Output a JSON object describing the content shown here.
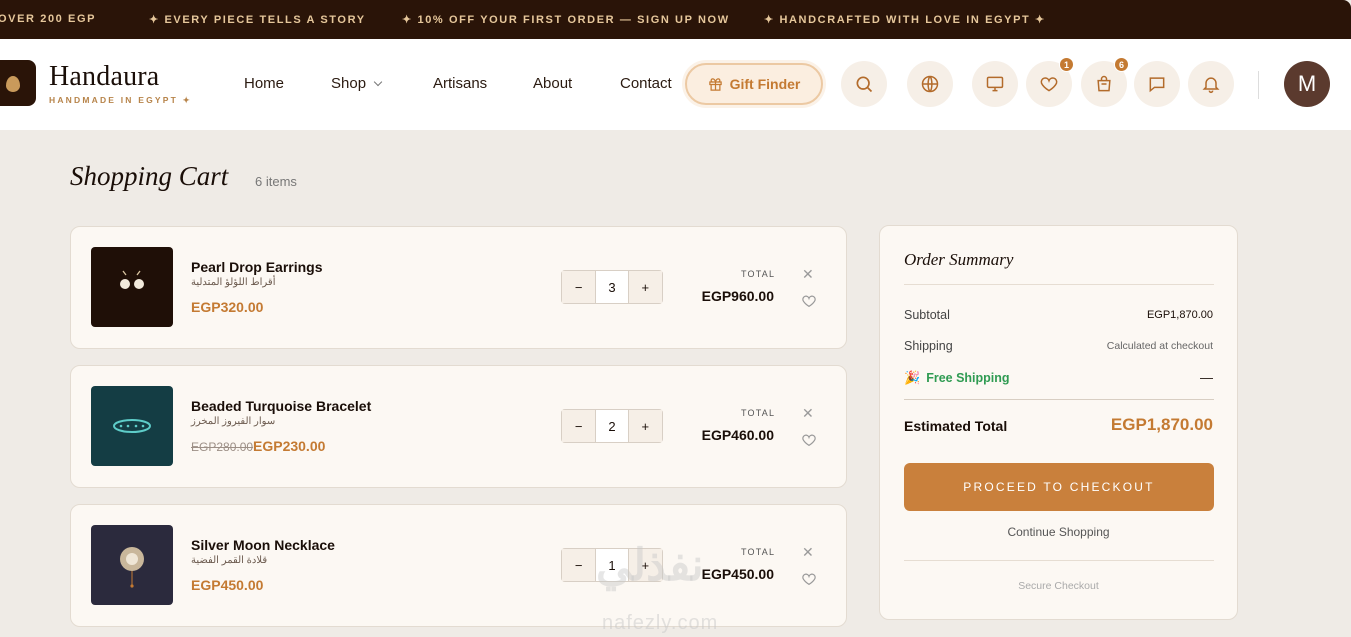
{
  "announcement": {
    "items": [
      "OVER 200 EGP",
      "✦ EVERY PIECE TELLS A STORY",
      "✦ 10% OFF YOUR FIRST ORDER — SIGN UP NOW",
      "✦ HANDCRAFTED WITH LOVE IN EGYPT ✦"
    ]
  },
  "header": {
    "brand": "Handaura",
    "tagline": "HANDMADE IN EGYPT ✦",
    "nav": [
      "Home",
      "Shop",
      "Artisans",
      "About",
      "Contact"
    ],
    "gift_finder": "Gift Finder",
    "wishlist_count": "1",
    "cart_count": "6",
    "avatar_initial": "M",
    "icons": [
      "search-icon",
      "globe-icon",
      "monitor-icon",
      "heart-icon",
      "bag-icon",
      "chat-icon",
      "bell-icon"
    ]
  },
  "cart": {
    "title": "Shopping Cart",
    "count_label": "6 items",
    "total_label": "TOTAL",
    "items": [
      {
        "name": "Pearl Drop Earrings",
        "arabic": "أقراط اللؤلؤ المتدلية",
        "price": "EGP320.00",
        "old_price": "",
        "qty": "3",
        "total": "EGP960.00"
      },
      {
        "name": "Beaded Turquoise Bracelet",
        "arabic": "سوار الفيروز المخرز",
        "price": "EGP230.00",
        "old_price": "EGP280.00",
        "qty": "2",
        "total": "EGP460.00"
      },
      {
        "name": "Silver Moon Necklace",
        "arabic": "قلادة القمر الفضية",
        "price": "EGP450.00",
        "old_price": "",
        "qty": "1",
        "total": "EGP450.00"
      }
    ]
  },
  "summary": {
    "title": "Order Summary",
    "subtotal_label": "Subtotal",
    "subtotal_value": "EGP1,870.00",
    "shipping_label": "Shipping",
    "shipping_value": "Calculated at checkout",
    "free_shipping_label": "Free Shipping",
    "free_shipping_value": "—",
    "estimated_label": "Estimated Total",
    "estimated_value": "EGP1,870.00",
    "checkout_button": "PROCEED TO CHECKOUT",
    "continue_link": "Continue Shopping",
    "secure_label": "Secure Checkout"
  },
  "watermark": {
    "arabic": "نفذلي",
    "latin": "nafezly.com"
  },
  "colors": {
    "accent": "#c47a32",
    "dark": "#2a1408",
    "success": "#2f9b52",
    "background": "#efebe6"
  }
}
